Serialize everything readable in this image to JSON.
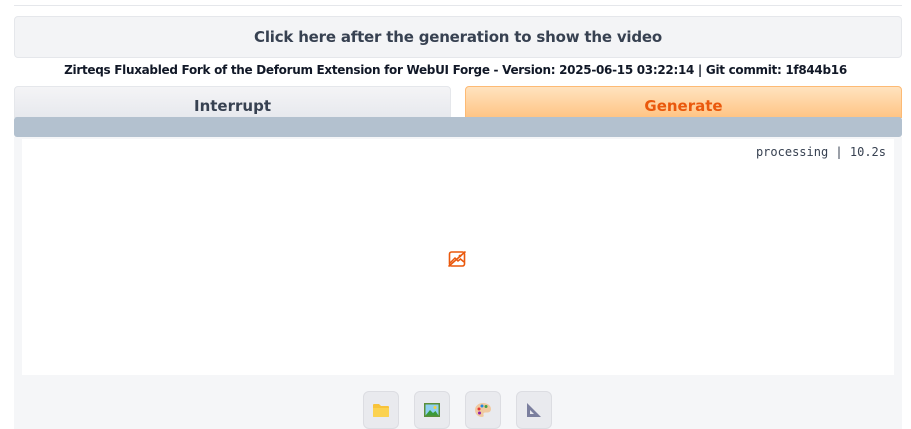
{
  "show_video_button": {
    "label": "Click here after the generation to show the video"
  },
  "version_info": "Zirteqs Fluxabled Fork of the Deforum Extension for WebUI Forge - Version: 2025-06-15 03:22:14 | Git commit: 1f844b16",
  "actions": {
    "interrupt_label": "Interrupt",
    "generate_label": "Generate"
  },
  "gallery": {
    "status": "processing | 10.2s",
    "placeholder_icon": "image-icon"
  },
  "toolbar": {
    "buttons": [
      {
        "icon": "folder-icon"
      },
      {
        "icon": "image-icon"
      },
      {
        "icon": "palette-icon"
      },
      {
        "icon": "triangle-ruler-icon"
      }
    ]
  },
  "colors": {
    "accent": "#ea580c",
    "generate_bg_top": "#ffe3bf",
    "generate_bg_bottom": "#ffc585",
    "progress": "#b3c1cf"
  }
}
